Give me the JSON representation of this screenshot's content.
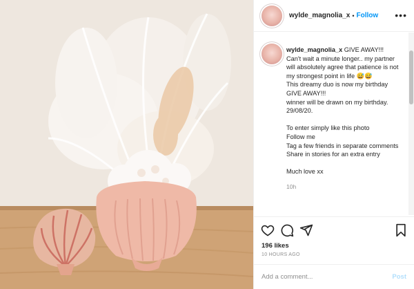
{
  "colors": {
    "accent": "#0095f6",
    "text": "#262626",
    "muted": "#8e8e8e",
    "border": "#efefef",
    "post_disabled": "#b2dffc"
  },
  "header": {
    "username": "wylde_magnolia_x",
    "separator": "•",
    "follow_label": "Follow",
    "more_icon": "more-dots-icon"
  },
  "caption": {
    "username": "wylde_magnolia_x",
    "text": " GIVE AWAY!!!\nCan't wait a minute longer.. my partner will absolutely agree that patience is not my strongest point in life 😅😅\nThis dreamy duo is now my birthday GIVE AWAY!!!\nwinner will be drawn on my birthday. 29/08/20.\n\nTo enter simply like this photo\nFollow me\nTag a few friends in separate comments\nShare in stories for an extra entry\n\nMuch love xx",
    "time": "10h"
  },
  "actions": {
    "icons": [
      "heart-icon",
      "comment-icon",
      "share-icon",
      "bookmark-icon"
    ],
    "likes": "196 likes",
    "posted": "10 HOURS AGO"
  },
  "comment_box": {
    "placeholder": "Add a comment...",
    "post_label": "Post"
  },
  "photo": {
    "subject": "dried flower arrangement in pink shell vase with seashell"
  }
}
